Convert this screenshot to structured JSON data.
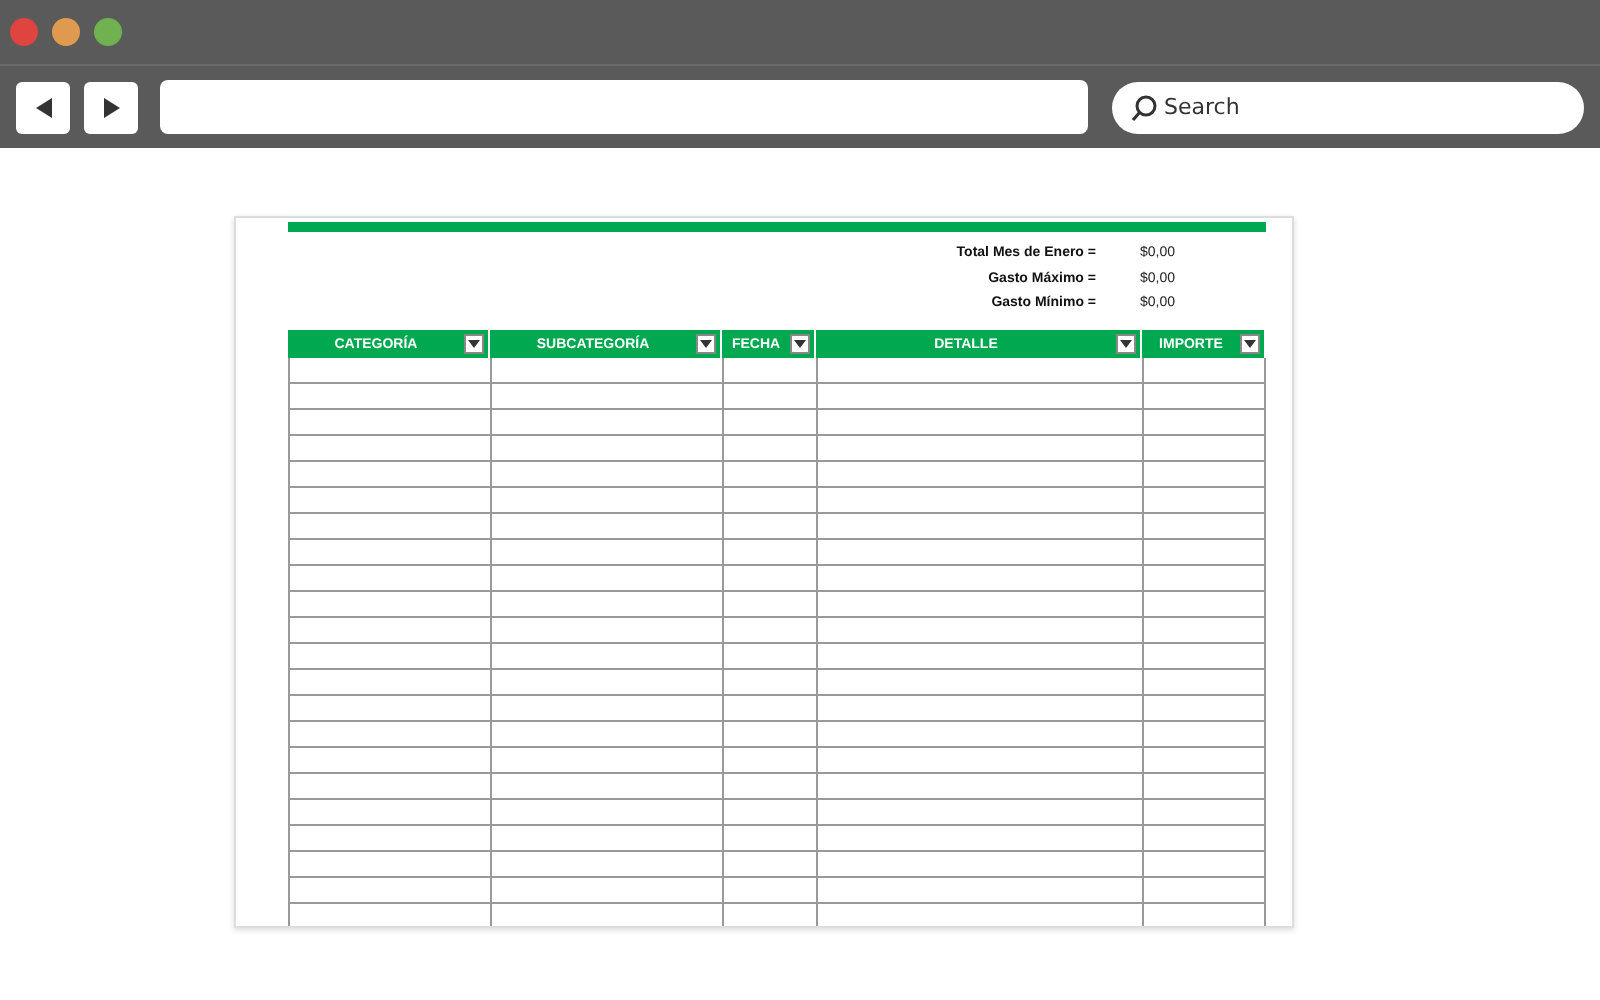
{
  "browser": {
    "search": {
      "placeholder": "Search"
    }
  },
  "summary": [
    {
      "label": "Total Mes de Enero =",
      "value": "$0,00"
    },
    {
      "label": "Gasto Máximo =",
      "value": "$0,00"
    },
    {
      "label": "Gasto Mínimo =",
      "value": "$0,00"
    }
  ],
  "table": {
    "columns": [
      "CATEGORÍA",
      "SUBCATEGORÍA",
      "FECHA",
      "DETALLE",
      "IMPORTE"
    ]
  }
}
